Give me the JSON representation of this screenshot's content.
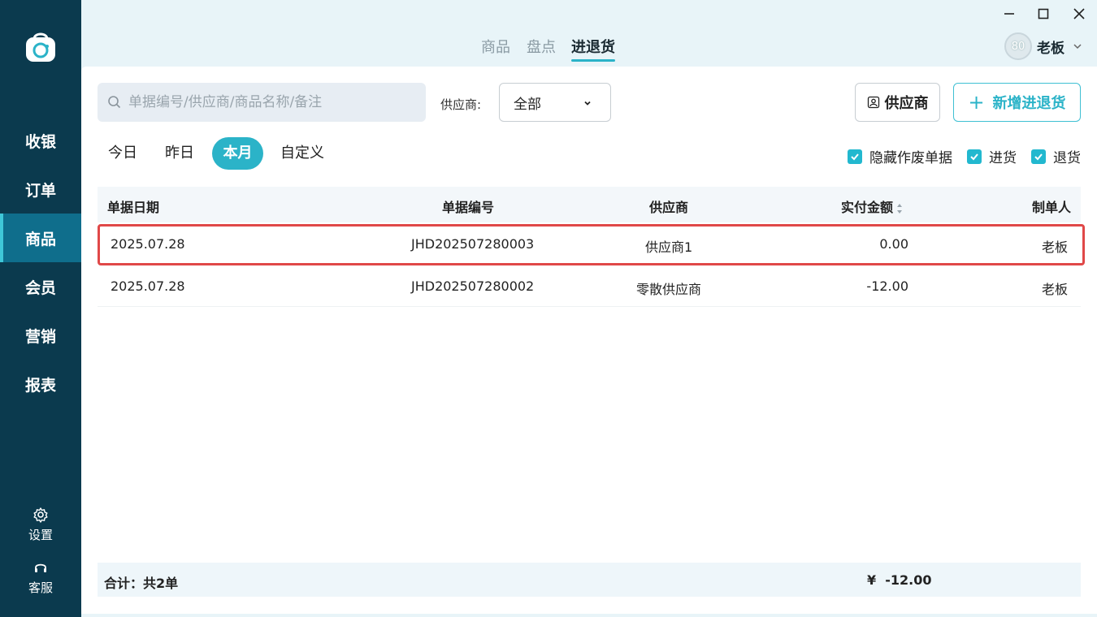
{
  "sidebar": {
    "items": [
      {
        "label": "收银"
      },
      {
        "label": "订单"
      },
      {
        "label": "商品"
      },
      {
        "label": "会员"
      },
      {
        "label": "营销"
      },
      {
        "label": "报表"
      }
    ],
    "active_index": 2,
    "settings_label": "设置",
    "service_label": "客服"
  },
  "top_tabs": [
    {
      "label": "商品"
    },
    {
      "label": "盘点"
    },
    {
      "label": "进退货"
    }
  ],
  "user": {
    "avatar_text": "80",
    "name": "老板"
  },
  "toolbar": {
    "search_placeholder": "单据编号/供应商/商品名称/备注",
    "supplier_label": "供应商:",
    "supplier_value": "全部",
    "supplier_button": "供应商",
    "new_button": "新增进退货"
  },
  "date_tabs": [
    {
      "label": "今日"
    },
    {
      "label": "昨日"
    },
    {
      "label": "本月"
    },
    {
      "label": "自定义"
    }
  ],
  "filters": [
    {
      "label": "隐藏作废单据",
      "checked": true
    },
    {
      "label": "进货",
      "checked": true
    },
    {
      "label": "退货",
      "checked": true
    }
  ],
  "table": {
    "columns": [
      "单据日期",
      "单据编号",
      "供应商",
      "实付金额",
      "制单人"
    ],
    "rows": [
      {
        "date": "2025.07.28",
        "number": "JHD202507280003",
        "supplier": "供应商1",
        "amount": "0.00",
        "maker": "老板"
      },
      {
        "date": "2025.07.28",
        "number": "JHD202507280002",
        "supplier": "零散供应商",
        "amount": "-12.00",
        "maker": "老板"
      }
    ]
  },
  "footer": {
    "summary": "合计：共2单",
    "total": "¥  -12.00"
  },
  "colors": {
    "sidebar": "#0b3a4e",
    "accent": "#2bb3c8",
    "highlight": "#e04848"
  }
}
